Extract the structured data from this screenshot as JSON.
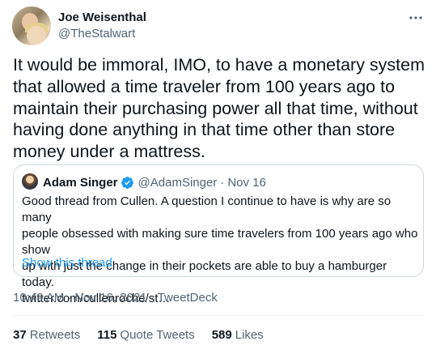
{
  "author": {
    "name": "Joe Weisenthal",
    "handle": "@TheStalwart"
  },
  "tweet": {
    "text": "It would be immoral, IMO, to have a monetary system\nthat allowed a time traveler from 100 years ago to\nmaintain their purchasing power all that time, without\nhaving done anything in that time other than store\nmoney under a mattress."
  },
  "quote": {
    "name": "Adam Singer",
    "handle": "@AdamSinger",
    "separator": "·",
    "date": "Nov 16",
    "text": "Good thread from Cullen. A question I continue to have is why are so many\npeople obsessed with making sure time travelers from 100 years ago who show\nup with just the change in their pockets are able to buy a hamburger today.\ntwitter.com/cullenroche/st…",
    "show_thread": "Show this thread"
  },
  "meta": {
    "time": "10:49 AM",
    "separator": "·",
    "date": "Nov 16, 2021",
    "source": "TweetDeck"
  },
  "stats": {
    "retweets_count": "37",
    "retweets_label": "Retweets",
    "quotes_count": "115",
    "quotes_label": "Quote Tweets",
    "likes_count": "589",
    "likes_label": "Likes"
  },
  "icons": {
    "more": "more-horizontal-icon",
    "verified": "verified-badge-icon"
  },
  "colors": {
    "accent": "#1d9bf0",
    "secondary_text": "#536471",
    "border": "#cfd9de"
  }
}
